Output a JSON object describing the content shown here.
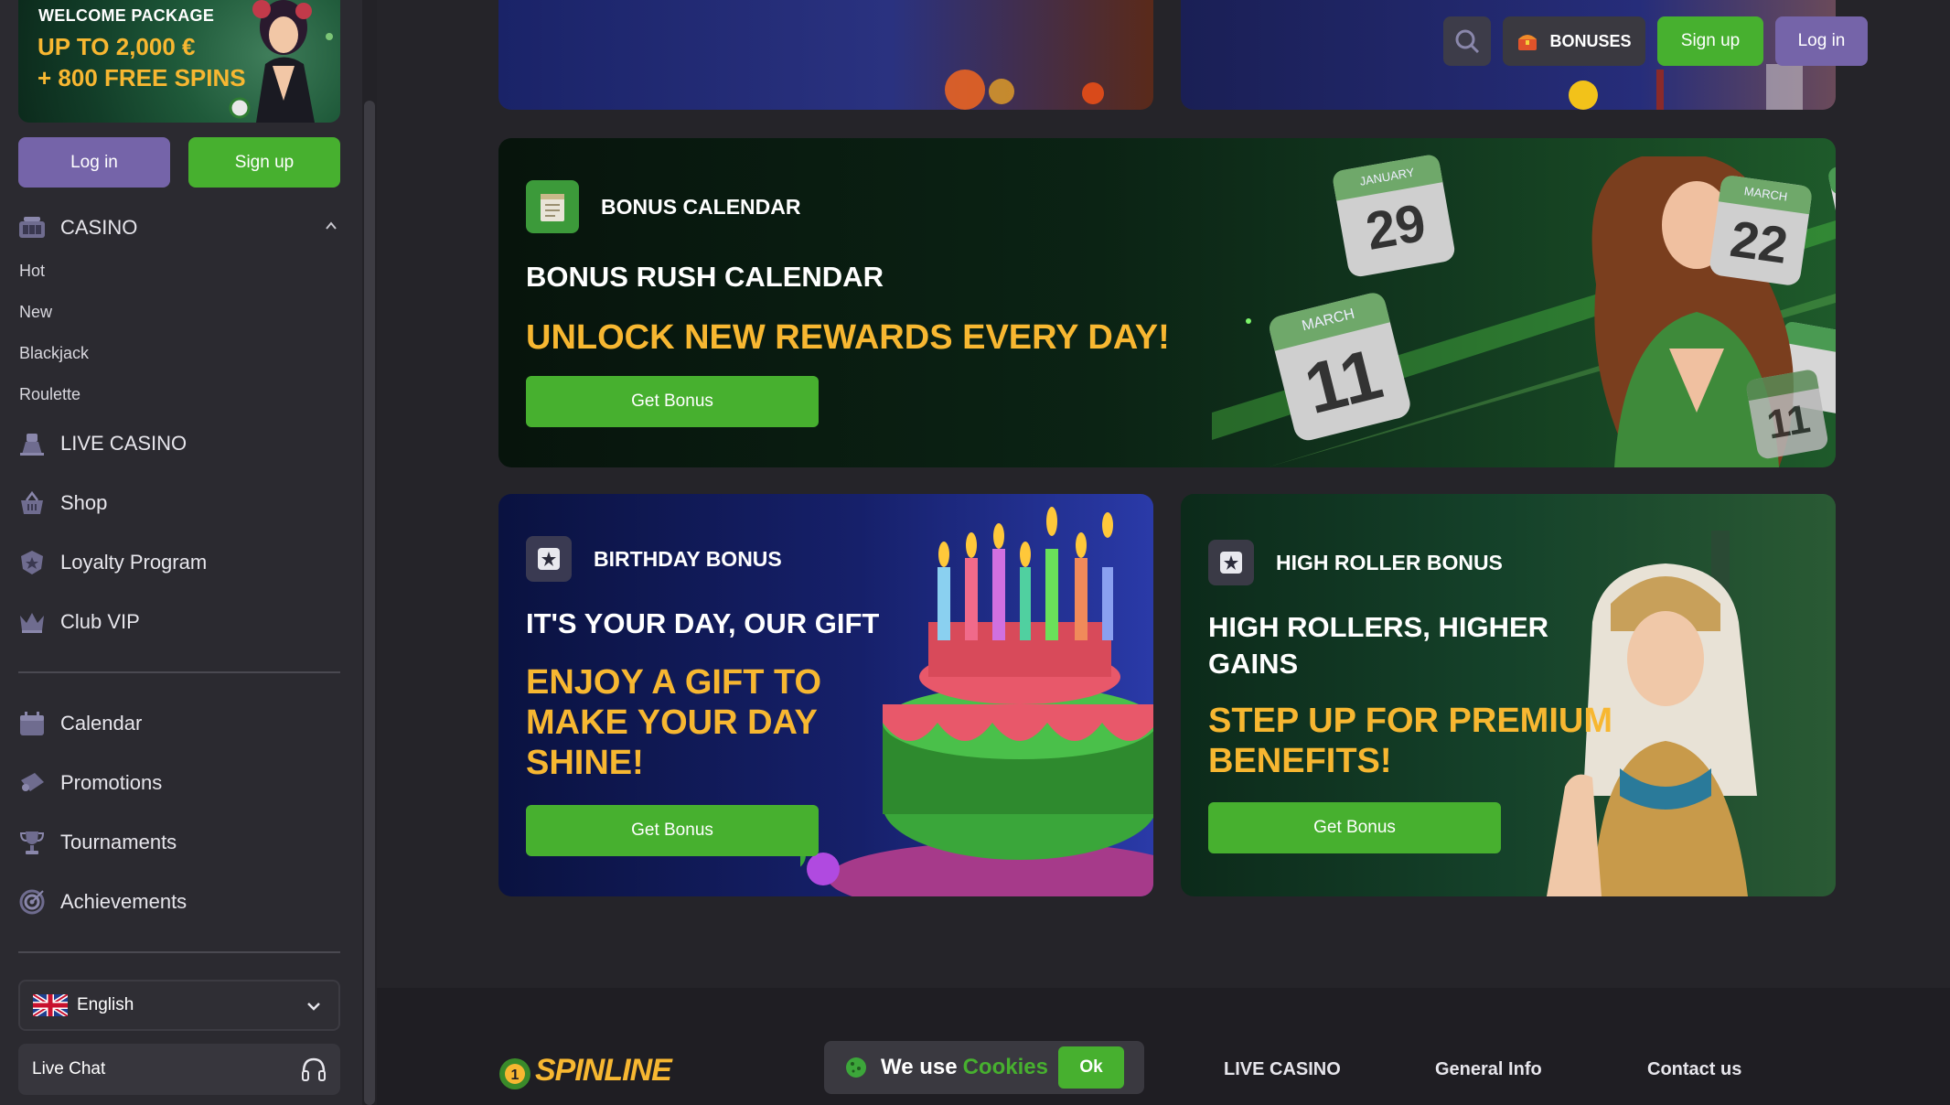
{
  "sidebar": {
    "promo": {
      "line1": "WELCOME PACKAGE",
      "line2": "UP TO 2,000 €",
      "line3": "+ 800 FREE SPINS"
    },
    "login_label": "Log in",
    "signup_label": "Sign up",
    "casino": {
      "label": "CASINO",
      "sub_items": [
        "Hot",
        "New",
        "Blackjack",
        "Roulette"
      ]
    },
    "items": [
      {
        "label": "LIVE CASINO",
        "icon": "live-casino-icon"
      },
      {
        "label": "Shop",
        "icon": "shop-basket-icon"
      },
      {
        "label": "Loyalty Program",
        "icon": "loyalty-badge-icon"
      },
      {
        "label": "Club VIP",
        "icon": "crown-icon"
      }
    ],
    "items2": [
      {
        "label": "Calendar",
        "icon": "calendar-icon"
      },
      {
        "label": "Promotions",
        "icon": "ticket-icon"
      },
      {
        "label": "Tournaments",
        "icon": "trophy-icon"
      },
      {
        "label": "Achievements",
        "icon": "target-icon"
      }
    ],
    "language": "English",
    "live_chat": "Live Chat"
  },
  "header": {
    "bonuses_label": "BONUSES",
    "signup_label": "Sign up",
    "login_label": "Log in"
  },
  "cards": {
    "calendar": {
      "badge": "BONUS CALENDAR",
      "title": "BONUS RUSH CALENDAR",
      "subtitle": "UNLOCK NEW REWARDS EVERY DAY!",
      "button": "Get Bonus",
      "dates": [
        {
          "month": "JANUARY",
          "day": "29"
        },
        {
          "month": "MARCH",
          "day": "22"
        },
        {
          "month": "MARCH",
          "day": "11"
        },
        {
          "month": "",
          "day": "11"
        }
      ]
    },
    "birthday": {
      "badge": "BIRTHDAY BONUS",
      "title": "IT'S YOUR DAY, OUR GIFT",
      "subtitle_lines": [
        "ENJOY A GIFT TO",
        "MAKE YOUR DAY",
        "SHINE!"
      ],
      "button": "Get Bonus"
    },
    "highroller": {
      "badge": "HIGH ROLLER BONUS",
      "title_lines": [
        "HIGH ROLLERS, HIGHER",
        "GAINS"
      ],
      "subtitle_lines": [
        "STEP UP FOR PREMIUM",
        "BENEFITS!"
      ],
      "button": "Get Bonus"
    }
  },
  "footer": {
    "brand": "SPINLINE",
    "cookie_text_1": "We use",
    "cookie_text_2": "Cookies",
    "cookie_ok": "Ok",
    "links": [
      "LIVE CASINO",
      "General Info",
      "Contact us"
    ]
  },
  "colors": {
    "accent_green": "#47b02f",
    "accent_purple": "#7564a9",
    "gold": "#f7b731",
    "bg": "#252429",
    "sidebar_bg": "#2b2a30"
  }
}
